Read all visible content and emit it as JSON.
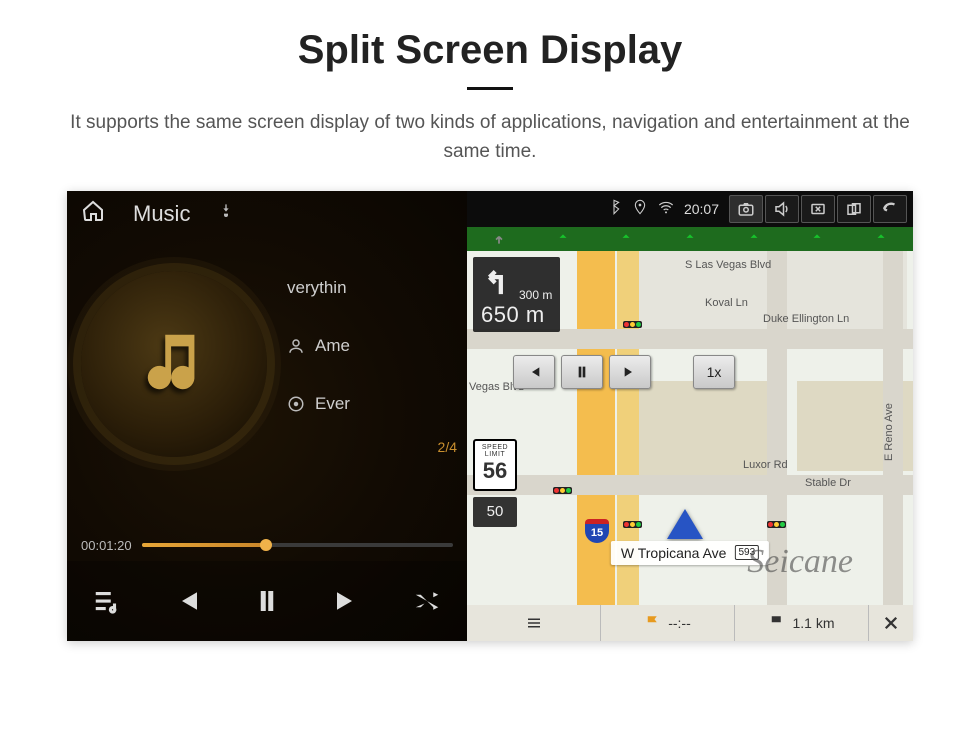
{
  "page": {
    "title": "Split Screen Display",
    "description": "It supports the same screen display of two kinds of applications, navigation and entertainment at the same time."
  },
  "music": {
    "header_title": "Music",
    "track_title": "verythin",
    "artist": "Ame",
    "album": "Ever",
    "track_index": "2/4",
    "elapsed": "00:01:20"
  },
  "status": {
    "time": "20:07"
  },
  "nav": {
    "next_turn_sub_m": "300 m",
    "next_turn_main_m": "650 m",
    "speed_limit": "56",
    "current_speed": "50",
    "road_name": "W Tropicana Ave",
    "road_shield": "593",
    "eta_time": "--:--",
    "distance_km": "1.1 km",
    "sim_speed": "1x",
    "labels": {
      "s_las_vegas": "S Las Vegas Blvd",
      "koval": "Koval Ln",
      "duke": "Duke Ellington Ln",
      "luxor": "Luxor Rd",
      "stable": "Stable Dr",
      "reno": "E Reno Ave",
      "vegas_blvd": "Vegas Blvd",
      "i15": "15"
    }
  },
  "watermark": "Seicane"
}
